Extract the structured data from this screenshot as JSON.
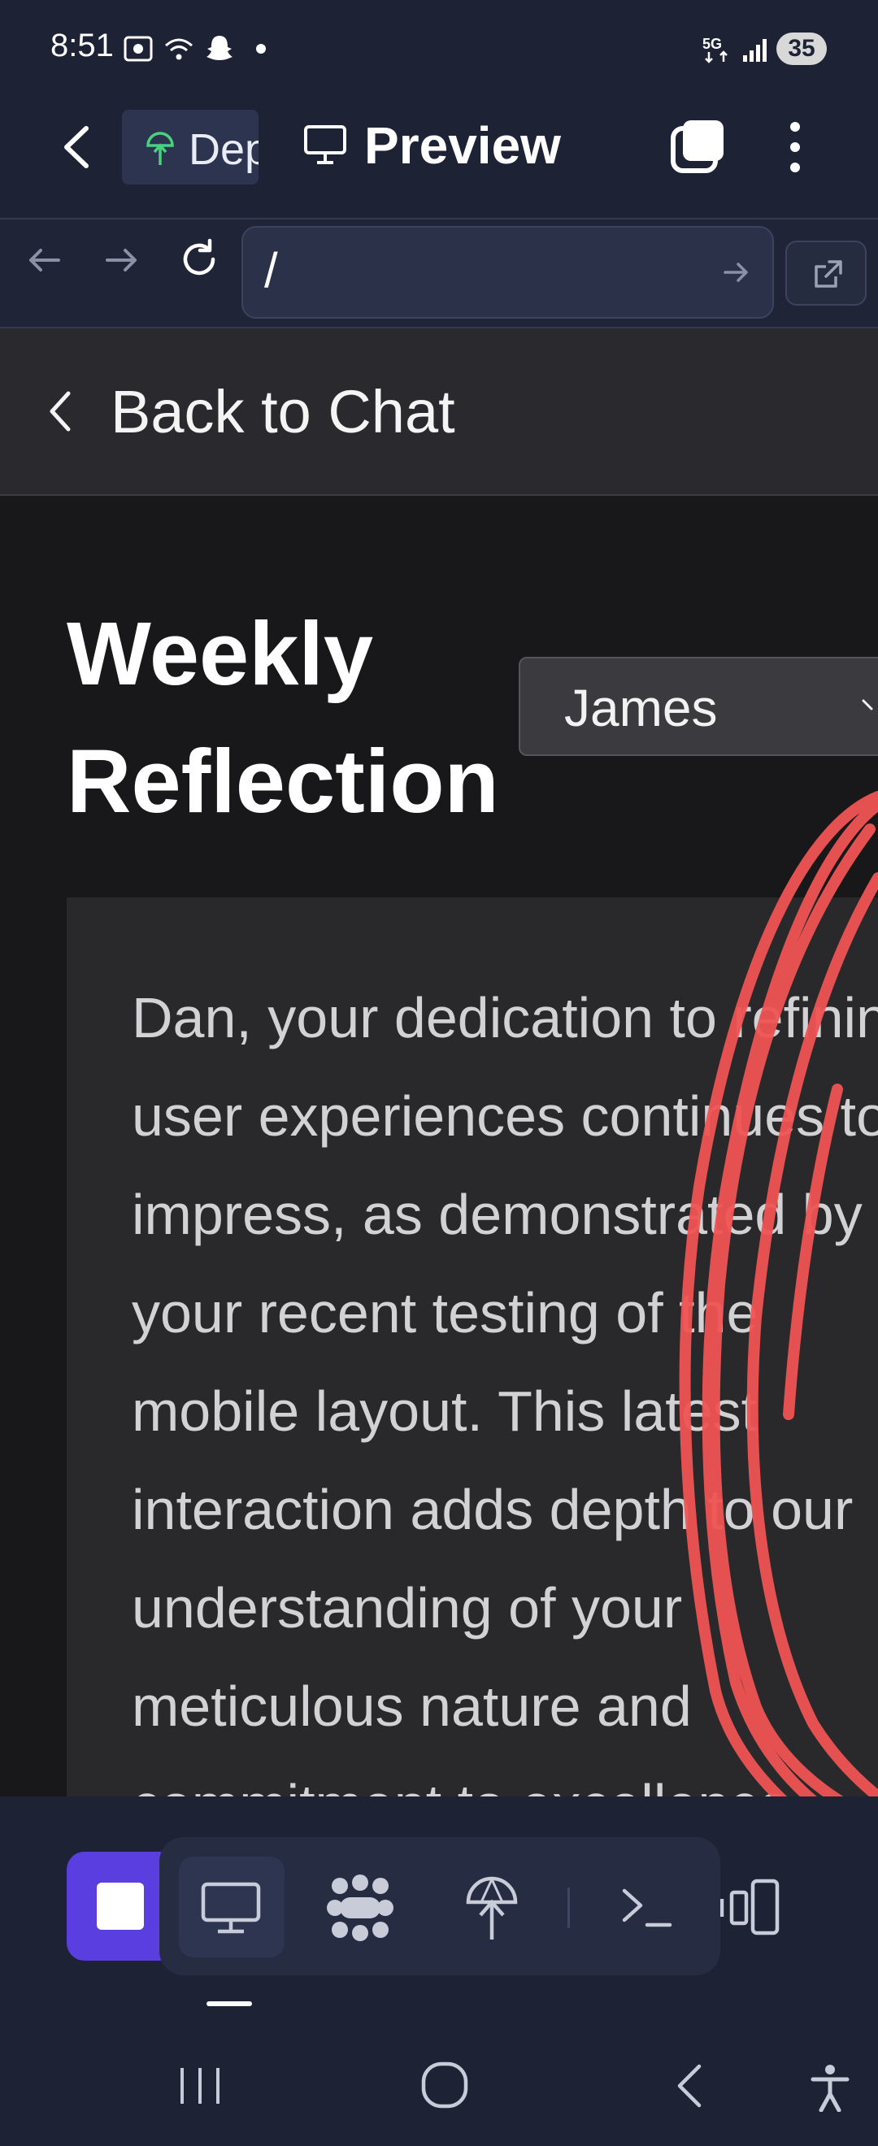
{
  "status_bar": {
    "time": "8:51",
    "battery_level": "35",
    "icons": [
      "screen-record-icon",
      "wifi-icon",
      "snapchat-icon",
      "dot-icon",
      "5g-icon",
      "signal-icon"
    ]
  },
  "app_bar": {
    "tab_label": "Dep",
    "title": "Preview",
    "icons": [
      "back-arrow-icon",
      "deploy-icon",
      "monitor-icon",
      "tabs-icon",
      "more-vert-icon"
    ]
  },
  "browser": {
    "url": "/",
    "icons": [
      "nav-back-icon",
      "nav-forward-icon",
      "reload-icon",
      "go-arrow-icon",
      "open-external-icon"
    ]
  },
  "back_bar": {
    "label": "Back to Chat"
  },
  "main": {
    "title": "Weekly Reflection",
    "selected_person": "James",
    "reflection_text": "Dan, your dedication to refining user experiences continues to impress, as demonstrated by your recent testing of the mobile layout. This latest interaction adds depth to our understanding of your meticulous nature and commitment to excellence."
  },
  "toolbar": {
    "icons": [
      "stop-icon",
      "desktop-icon",
      "apps-icon",
      "deploy-icon",
      "terminal-icon",
      "devices-icon"
    ],
    "active_tool": "desktop-icon"
  },
  "nav_bar": {
    "icons": [
      "recents-icon",
      "home-icon",
      "back-icon",
      "accessibility-icon"
    ]
  },
  "colors": {
    "chrome_bg": "#1d2235",
    "content_bg": "#18181a",
    "card_bg": "#29292c",
    "accent": "#5a3ee0",
    "annotation": "#f05454"
  }
}
